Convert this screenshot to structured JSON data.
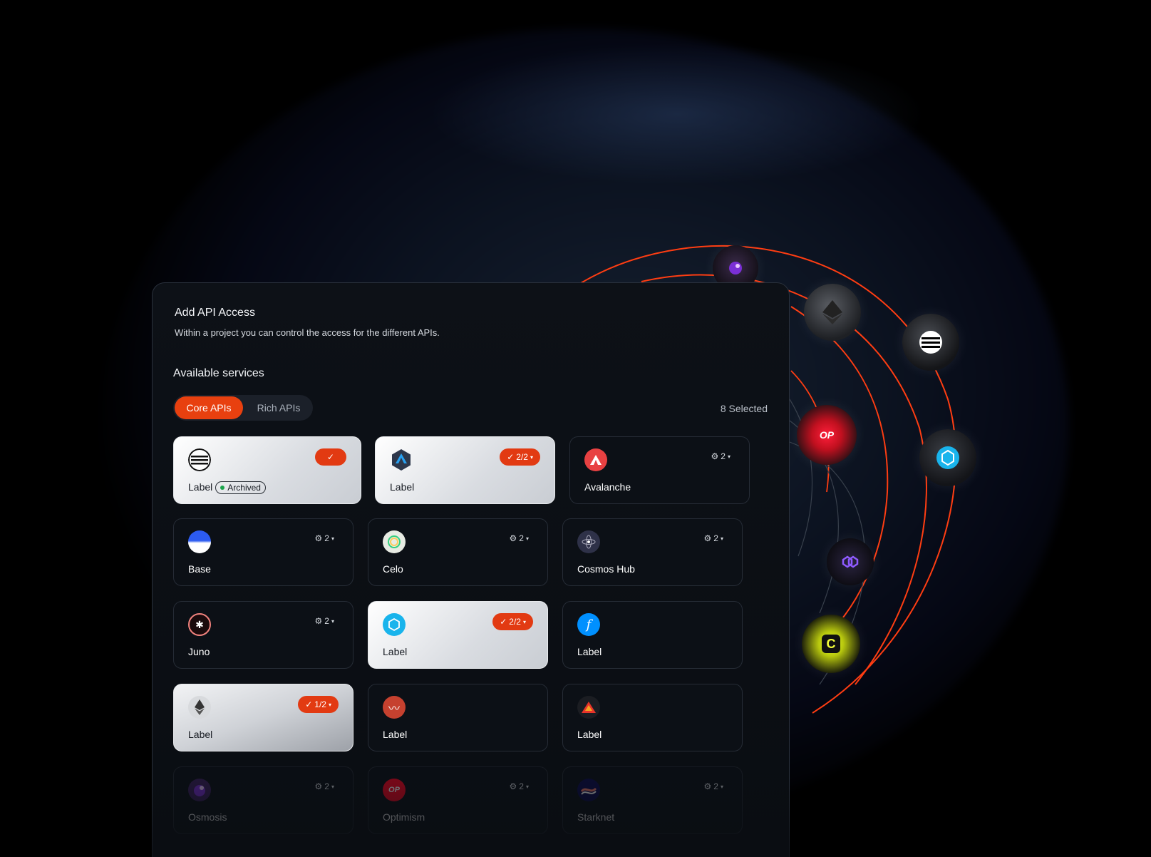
{
  "dialog": {
    "title": "Add API Access",
    "subtitle": "Within a project you can control the access for the different APIs.",
    "section_title": "Available services",
    "tabs": [
      {
        "label": "Core APIs",
        "active": true
      },
      {
        "label": "Rich APIs",
        "active": false
      }
    ],
    "selected_count": "8 Selected",
    "archived_label": "Archived",
    "cards": [
      {
        "label": "Label",
        "icon": "aptos-icon",
        "state": "selected",
        "badge": ""
      },
      {
        "label": "Label",
        "icon": "arbitrum-icon",
        "state": "selected",
        "badge": "2/2"
      },
      {
        "label": "Avalanche",
        "icon": "avalanche-icon",
        "state": "unselected",
        "badge": "2"
      },
      {
        "label": "Base",
        "icon": "base-icon",
        "state": "unselected",
        "badge": "2"
      },
      {
        "label": "Celo",
        "icon": "celo-icon",
        "state": "unselected",
        "badge": "2"
      },
      {
        "label": "Cosmos Hub",
        "icon": "cosmos-icon",
        "state": "unselected",
        "badge": "2"
      },
      {
        "label": "Juno",
        "icon": "juno-icon",
        "state": "unselected",
        "badge": "2"
      },
      {
        "label": "Label",
        "icon": "fantom-icon",
        "state": "selected",
        "badge": "2/2"
      },
      {
        "label": "Label",
        "icon": "filecoin-icon",
        "state": "unselected",
        "badge": ""
      },
      {
        "label": "Label",
        "icon": "ethereum-icon",
        "state": "selected",
        "badge": "1/2"
      },
      {
        "label": "Label",
        "icon": "harmony-icon",
        "state": "unselected",
        "badge": ""
      },
      {
        "label": "Label",
        "icon": "arweave-icon",
        "state": "unselected",
        "badge": ""
      },
      {
        "label": "Osmosis",
        "icon": "osmosis-icon",
        "state": "faded",
        "badge": "2"
      },
      {
        "label": "Optimism",
        "icon": "optimism-icon",
        "state": "faded",
        "badge": "2"
      },
      {
        "label": "Starknet",
        "icon": "starknet-icon",
        "state": "faded",
        "badge": "2"
      }
    ]
  },
  "orbit_nodes": [
    {
      "name": "osmosis-node-icon",
      "text": ""
    },
    {
      "name": "ethereum-node-icon",
      "text": ""
    },
    {
      "name": "aptos-node-icon",
      "text": ""
    },
    {
      "name": "optimism-node-icon",
      "text": "OP"
    },
    {
      "name": "fantom-node-icon",
      "text": ""
    },
    {
      "name": "polygon-node-icon",
      "text": ""
    },
    {
      "name": "celo-node-icon",
      "text": "C"
    }
  ],
  "colors": {
    "accent": "#e8400f",
    "orbit": "#ff3d12",
    "panel_bg": "#0d1117"
  }
}
